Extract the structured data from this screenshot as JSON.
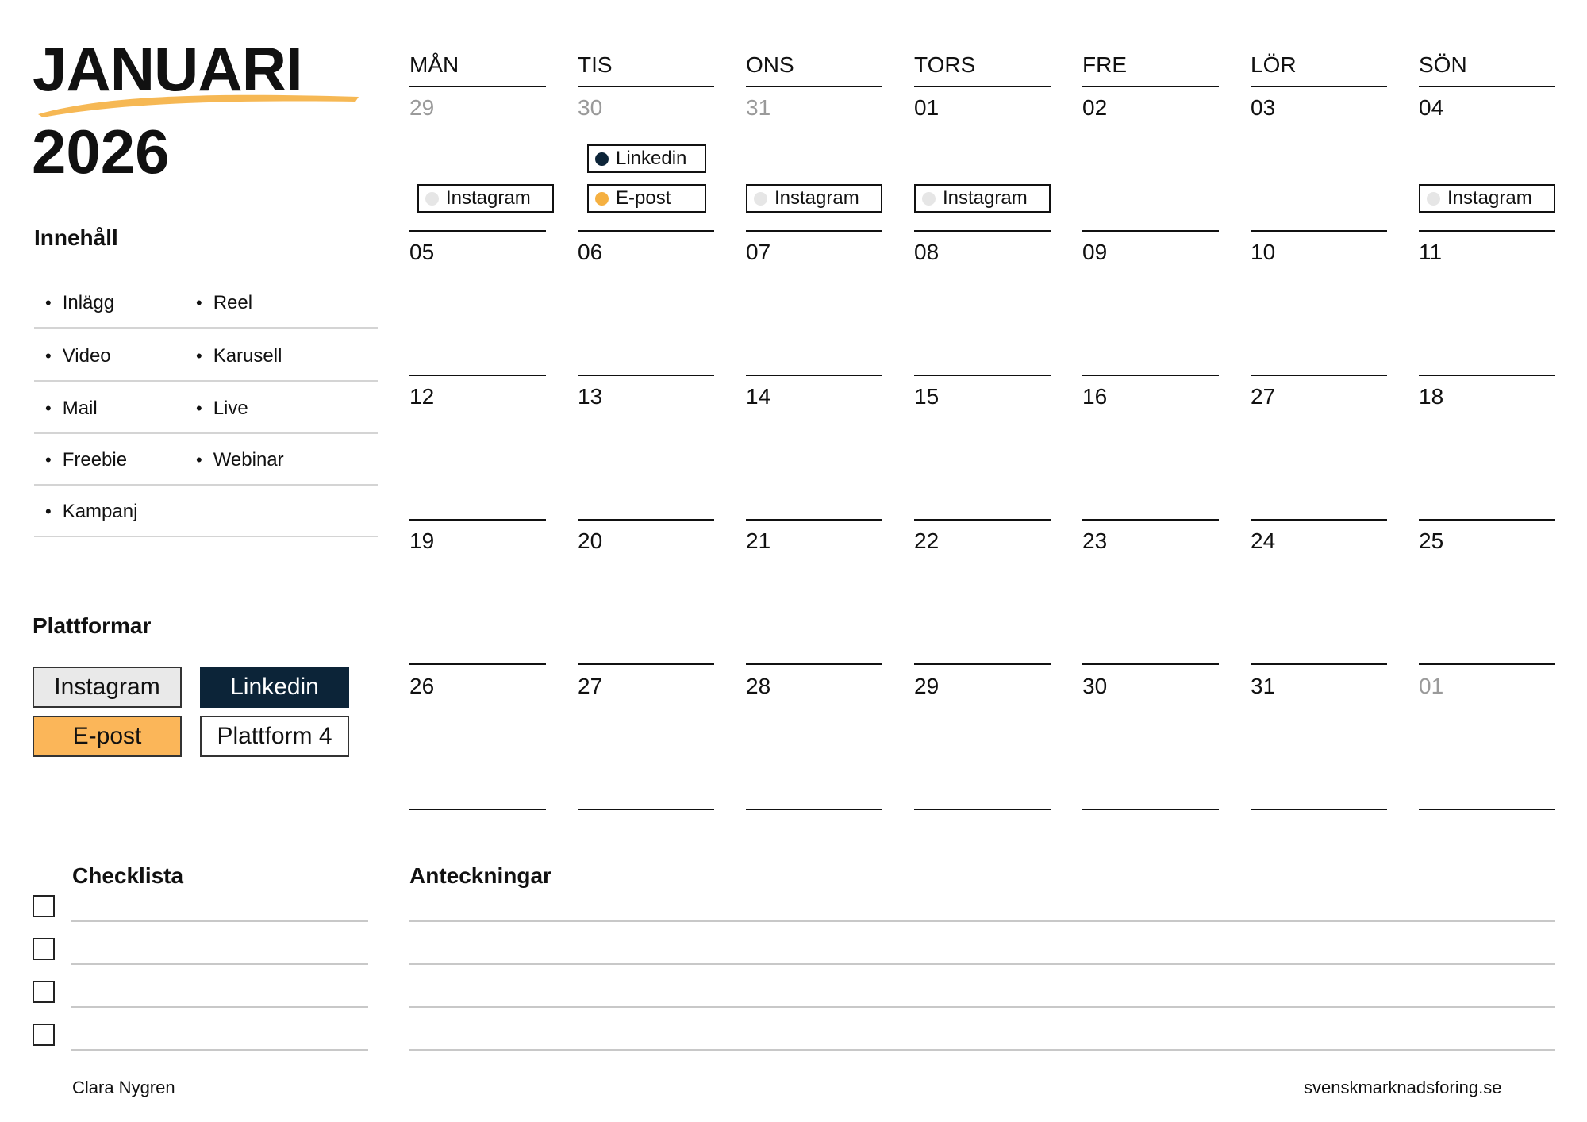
{
  "header": {
    "month": "JANUARI",
    "year": "2026",
    "brush_color": "#f5b041"
  },
  "content_section": {
    "title": "Innehåll",
    "rows": [
      [
        "Inlägg",
        "Reel"
      ],
      [
        "Video",
        "Karusell"
      ],
      [
        "Mail",
        "Live"
      ],
      [
        "Freebie",
        "Webinar"
      ],
      [
        "Kampanj",
        ""
      ]
    ]
  },
  "platforms_section": {
    "title": "Plattformar",
    "items": [
      {
        "label": "Instagram",
        "bg": "#e9e9e9",
        "fg": "#111111"
      },
      {
        "label": "Linkedin",
        "bg": "#0c2438",
        "fg": "#ffffff"
      },
      {
        "label": "E-post",
        "bg": "#fbb659",
        "fg": "#111111"
      },
      {
        "label": "Plattform 4",
        "bg": "#ffffff",
        "fg": "#111111"
      }
    ]
  },
  "calendar": {
    "weekdays": [
      "MÅN",
      "TIS",
      "ONS",
      "TORS",
      "FRE",
      "LÖR",
      "SÖN"
    ],
    "weeks": [
      [
        {
          "day": "29",
          "muted": true,
          "tags": [
            {
              "label": "Instagram",
              "color": "#e6e6e6"
            }
          ]
        },
        {
          "day": "30",
          "muted": true,
          "tags": [
            {
              "label": "Linkedin",
              "color": "#0c2438"
            },
            {
              "label": "E-post",
              "color": "#f5b041"
            }
          ]
        },
        {
          "day": "31",
          "muted": true,
          "tags": [
            {
              "label": "Instagram",
              "color": "#e6e6e6"
            }
          ]
        },
        {
          "day": "01",
          "muted": false,
          "tags": [
            {
              "label": "Instagram",
              "color": "#e6e6e6"
            }
          ]
        },
        {
          "day": "02",
          "muted": false,
          "tags": []
        },
        {
          "day": "03",
          "muted": false,
          "tags": []
        },
        {
          "day": "04",
          "muted": false,
          "tags": [
            {
              "label": "Instagram",
              "color": "#e6e6e6"
            }
          ]
        }
      ],
      [
        {
          "day": "05",
          "muted": false,
          "tags": []
        },
        {
          "day": "06",
          "muted": false,
          "tags": []
        },
        {
          "day": "07",
          "muted": false,
          "tags": []
        },
        {
          "day": "08",
          "muted": false,
          "tags": []
        },
        {
          "day": "09",
          "muted": false,
          "tags": []
        },
        {
          "day": "10",
          "muted": false,
          "tags": []
        },
        {
          "day": "11",
          "muted": false,
          "tags": []
        }
      ],
      [
        {
          "day": "12",
          "muted": false,
          "tags": []
        },
        {
          "day": "13",
          "muted": false,
          "tags": []
        },
        {
          "day": "14",
          "muted": false,
          "tags": []
        },
        {
          "day": "15",
          "muted": false,
          "tags": []
        },
        {
          "day": "16",
          "muted": false,
          "tags": []
        },
        {
          "day": "27",
          "muted": false,
          "tags": []
        },
        {
          "day": "18",
          "muted": false,
          "tags": []
        }
      ],
      [
        {
          "day": "19",
          "muted": false,
          "tags": []
        },
        {
          "day": "20",
          "muted": false,
          "tags": []
        },
        {
          "day": "21",
          "muted": false,
          "tags": []
        },
        {
          "day": "22",
          "muted": false,
          "tags": []
        },
        {
          "day": "23",
          "muted": false,
          "tags": []
        },
        {
          "day": "24",
          "muted": false,
          "tags": []
        },
        {
          "day": "25",
          "muted": false,
          "tags": []
        }
      ],
      [
        {
          "day": "26",
          "muted": false,
          "tags": []
        },
        {
          "day": "27",
          "muted": false,
          "tags": []
        },
        {
          "day": "28",
          "muted": false,
          "tags": []
        },
        {
          "day": "29",
          "muted": false,
          "tags": []
        },
        {
          "day": "30",
          "muted": false,
          "tags": []
        },
        {
          "day": "31",
          "muted": false,
          "tags": []
        },
        {
          "day": "01",
          "muted": true,
          "tags": []
        }
      ]
    ]
  },
  "checklist": {
    "title": "Checklista",
    "count": 4
  },
  "notes": {
    "title": "Anteckningar",
    "lines": 4
  },
  "footer": {
    "author": "Clara Nygren",
    "website": "svenskmarknadsforing.se"
  }
}
